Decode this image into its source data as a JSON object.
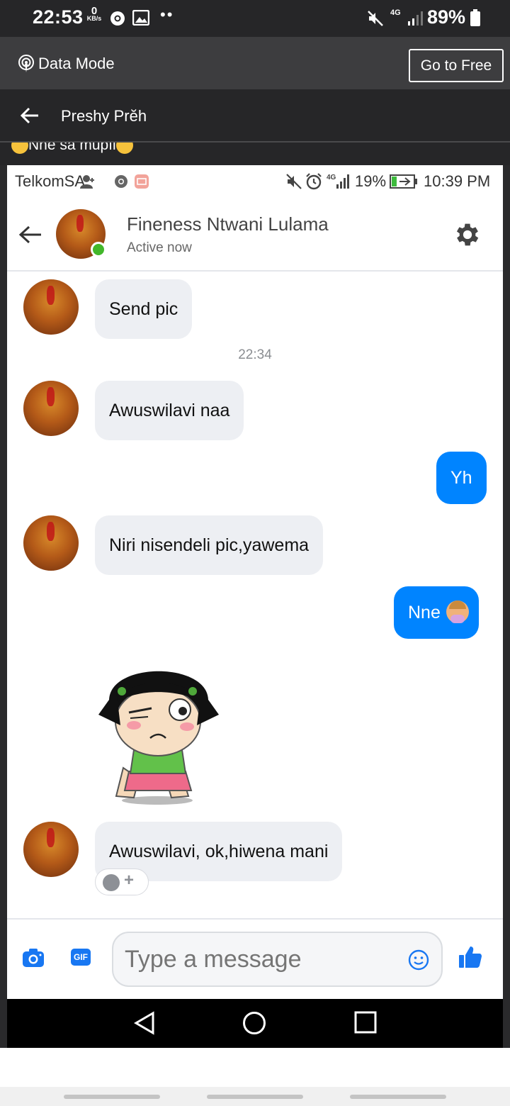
{
  "outer_status": {
    "time": "22:53",
    "net_speed": "0",
    "net_unit": "KB/s",
    "battery": "89%",
    "network": "4G"
  },
  "data_bar": {
    "label": "Data Mode",
    "button": "Go to Free"
  },
  "outer_header": {
    "contact": "Preshy Prĕh",
    "preview": "Nne sa mupfi"
  },
  "phone_status": {
    "carrier": "TelkomSA",
    "battery": "19%",
    "time": "10:39 PM",
    "network": "4G"
  },
  "chat_header": {
    "name": "Fineness Ntwani Lulama",
    "status": "Active now"
  },
  "messages": [
    {
      "text": "Send pic",
      "direction": "in"
    },
    {
      "text": "22:34",
      "direction": "timestamp"
    },
    {
      "text": "Awuswilavi naa",
      "direction": "in"
    },
    {
      "text": "Yh",
      "direction": "out"
    },
    {
      "text": "Niri nisendeli pic,yawema",
      "direction": "in"
    },
    {
      "text": "Nne",
      "direction": "out"
    },
    {
      "text": "Awuswilavi, ok,hiwena mani",
      "direction": "in"
    }
  ],
  "composer": {
    "placeholder": "Type a message",
    "gif_label": "GIF"
  },
  "colors": {
    "outgoing_bubble": "#0084ff",
    "incoming_bubble": "#edeff3",
    "online": "#42b72a",
    "dark_bar": "#262628"
  }
}
